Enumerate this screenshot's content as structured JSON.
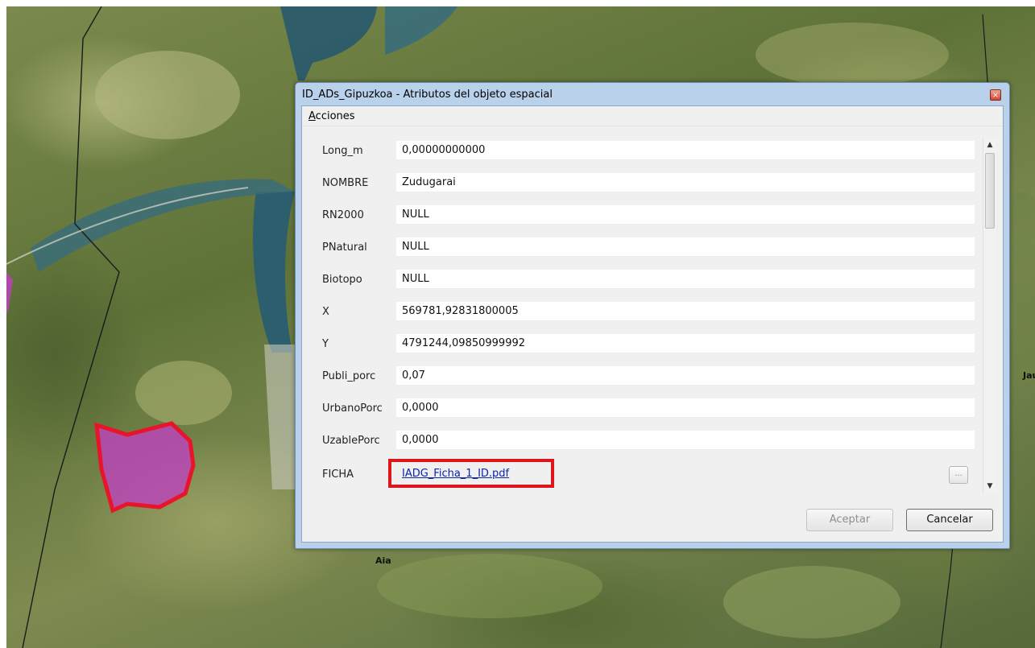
{
  "dialog": {
    "title": "ID_ADs_Gipuzkoa - Atributos del objeto espacial",
    "close_glyph": "×",
    "menu": {
      "acciones_mnemonic": "A",
      "acciones_rest": "cciones"
    },
    "fields": [
      {
        "label": "Long_m",
        "value": "0,00000000000"
      },
      {
        "label": "NOMBRE",
        "value": "Zudugarai"
      },
      {
        "label": "RN2000",
        "value": "NULL"
      },
      {
        "label": "PNatural",
        "value": "NULL"
      },
      {
        "label": "Biotopo",
        "value": "NULL"
      },
      {
        "label": "X",
        "value": "569781,92831800005"
      },
      {
        "label": "Y",
        "value": "4791244,09850999992"
      },
      {
        "label": "Publi_porc",
        "value": "0,07"
      },
      {
        "label": "UrbanoPorc",
        "value": "0,0000"
      },
      {
        "label": "UzablePorc",
        "value": "0,0000"
      }
    ],
    "ficha": {
      "label": "FICHA",
      "link": "IADG_Ficha_1_ID.pdf",
      "browse_label": "..."
    },
    "scroll": {
      "up": "▲",
      "down": "▼"
    },
    "buttons": {
      "accept": "Aceptar",
      "cancel": "Cancelar"
    }
  },
  "map": {
    "labels": {
      "aia": "Aia",
      "jau": "Jau"
    },
    "colors": {
      "water": "#2a5a6a",
      "polygon_fill": "#c040c0",
      "polygon_stroke": "#e8142a"
    }
  }
}
